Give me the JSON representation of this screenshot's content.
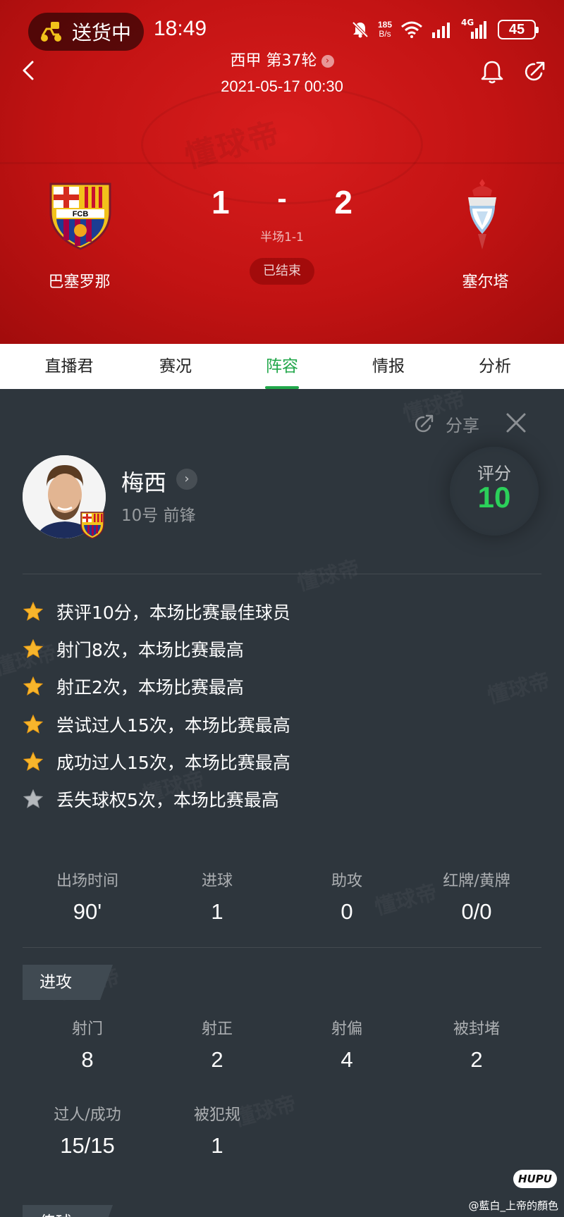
{
  "status_bar": {
    "delivery_text": "送货中",
    "time": "18:49",
    "net_speed_value": "185",
    "net_speed_unit": "B/s",
    "network_label": "4G",
    "battery": "45"
  },
  "match": {
    "league": "西甲 第37轮",
    "datetime": "2021-05-17 00:30",
    "home_team": "巴塞罗那",
    "away_team": "塞尔塔",
    "home_score": "1",
    "score_separator": "-",
    "away_score": "2",
    "halftime": "半场1-1",
    "status": "已结束",
    "home_crest_text": "FCB",
    "watermark": "懂球帝"
  },
  "tabs": [
    {
      "label": "直播君",
      "active": false
    },
    {
      "label": "赛况",
      "active": false
    },
    {
      "label": "阵容",
      "active": true
    },
    {
      "label": "情报",
      "active": false
    },
    {
      "label": "分析",
      "active": false
    }
  ],
  "panel": {
    "share_label": "分享",
    "watermark": "懂球帝"
  },
  "player": {
    "name": "梅西",
    "position": "10号 前锋",
    "rating_label": "评分",
    "rating": "10"
  },
  "highlights": [
    {
      "text": "获评10分，本场比赛最佳球员",
      "star": "gold"
    },
    {
      "text": "射门8次，本场比赛最高",
      "star": "gold"
    },
    {
      "text": "射正2次，本场比赛最高",
      "star": "gold"
    },
    {
      "text": "尝试过人15次，本场比赛最高",
      "star": "gold"
    },
    {
      "text": "成功过人15次，本场比赛最高",
      "star": "gold"
    },
    {
      "text": "丢失球权5次，本场比赛最高",
      "star": "silver"
    }
  ],
  "summary_stats": [
    {
      "label": "出场时间",
      "value": "90'"
    },
    {
      "label": "进球",
      "value": "1"
    },
    {
      "label": "助攻",
      "value": "0"
    },
    {
      "label": "红牌/黄牌",
      "value": "0/0"
    }
  ],
  "attack": {
    "title": "进攻",
    "row1": [
      {
        "label": "射门",
        "value": "8"
      },
      {
        "label": "射正",
        "value": "2"
      },
      {
        "label": "射偏",
        "value": "4"
      },
      {
        "label": "被封堵",
        "value": "2"
      }
    ],
    "row2": [
      {
        "label": "过人/成功",
        "value": "15/15"
      },
      {
        "label": "被犯规",
        "value": "1"
      }
    ]
  },
  "passing": {
    "title": "传球"
  },
  "footer": {
    "hupu_logo": "HUPU",
    "credit": "@藍白_上帝的顏色"
  },
  "colors": {
    "header_red": "#c21313",
    "accent_green": "#21a74a",
    "rating_green": "#2bd05a",
    "panel_bg": "#2e363d",
    "star_gold": "#f7b52c",
    "star_silver": "#b5b9bd"
  },
  "icons": {
    "back": "chevron-left-icon",
    "bell": "bell-icon",
    "share": "share-icon",
    "close": "close-icon",
    "star": "star-icon"
  }
}
